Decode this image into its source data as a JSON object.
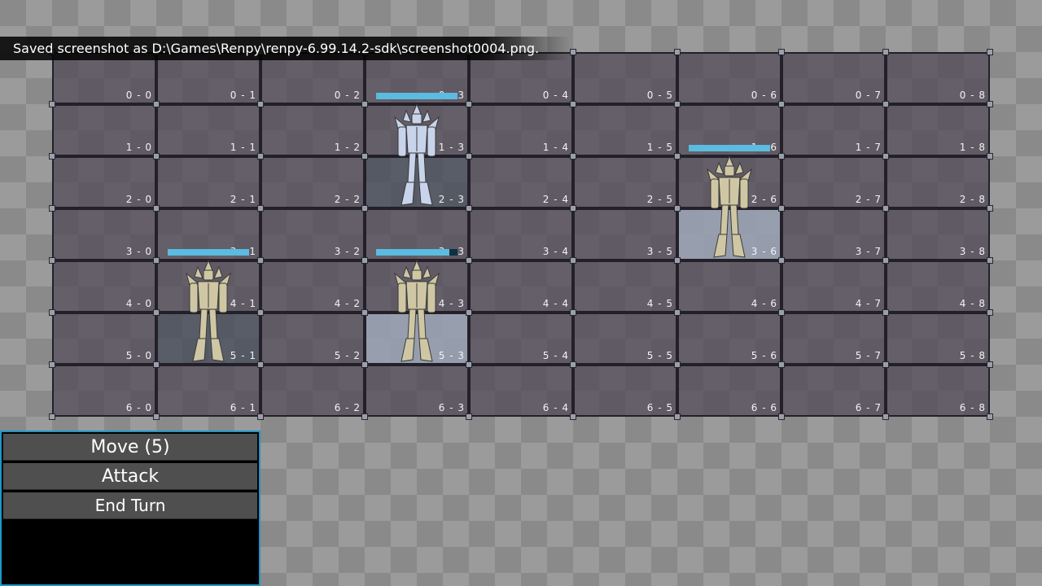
{
  "notification": "Saved screenshot as D:\\Games\\Renpy\\renpy-6.99.14.2-sdk\\screenshot0004.png.",
  "grid": {
    "rows": 7,
    "cols": 9,
    "highlighted_dark": [
      "2-3",
      "5-1"
    ],
    "highlighted_light": [
      "3-6",
      "5-3"
    ]
  },
  "units": [
    {
      "name": "blue-mech",
      "faction": "player",
      "color": "#c8d4ec",
      "row": 2,
      "col": 3,
      "hp_fraction": 1.0
    },
    {
      "name": "tan-mech",
      "faction": "enemy",
      "color": "#cfc6a4",
      "row": 3,
      "col": 6,
      "hp_fraction": 1.0
    },
    {
      "name": "tan-mech",
      "faction": "enemy",
      "color": "#cfc6a4",
      "row": 5,
      "col": 1,
      "hp_fraction": 1.0
    },
    {
      "name": "tan-mech",
      "faction": "enemy",
      "color": "#cfc6a4",
      "row": 5,
      "col": 3,
      "hp_fraction": 0.9
    }
  ],
  "menu": {
    "move_label": "Move (5)",
    "attack_label": "Attack",
    "end_turn_label": "End Turn"
  },
  "colors": {
    "hp_bar": "#5bbbe0",
    "menu_border": "#1e98c8",
    "button_bg": "#4f4f4f"
  }
}
